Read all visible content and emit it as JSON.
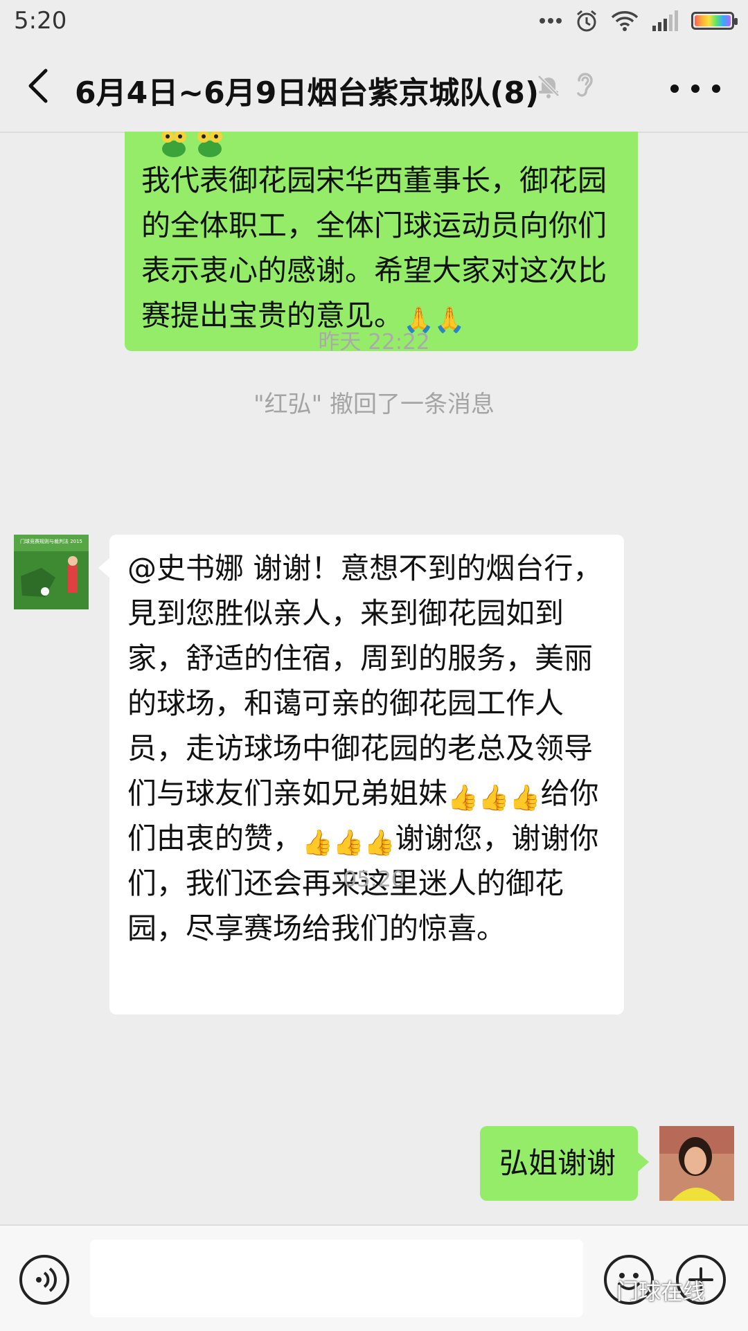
{
  "status_bar": {
    "time": "5:20"
  },
  "header": {
    "title": "6月4日~6月9日烟台紫京城队(8)"
  },
  "messages": {
    "top_green": "我代表御花园宋华西董事长，御花园的全体职工，全体门球运动员向你们表示衷心的感谢。希望大家对这次比赛提出宝贵的意见。",
    "timestamp_1": "昨天 22:22",
    "system_recall": "\"红弘\" 撤回了一条消息",
    "incoming": {
      "part1": "@史书娜  谢谢！意想不到的烟台行，見到您胜似亲人，来到御花园如到家，舒适的住宿，周到的服务，美丽的球场，和蔼可亲的御花园工作人员，走访球场中御花园的老总及领导们与球友们亲如兄弟姐妹",
      "part2": "给你们由衷的赞，",
      "part3": "谢谢您，谢谢你们，我们还会再来这里迷人的御花园，尽享赛场给我们的惊喜。"
    },
    "timestamp_2": "05:20",
    "outgoing_reply": "弘姐谢谢"
  },
  "avatars": {
    "left_caption": "门球竞赛规则与裁判法 2015"
  },
  "watermark": "门球在线",
  "colors": {
    "bg": "#ededed",
    "bubble_sent": "#95ec69",
    "bubble_received": "#ffffff"
  },
  "icons": {
    "reaction": "folded-hands-emoji",
    "like": "thumbs-up-emoji",
    "top_decor": "green-frog-emoji"
  }
}
